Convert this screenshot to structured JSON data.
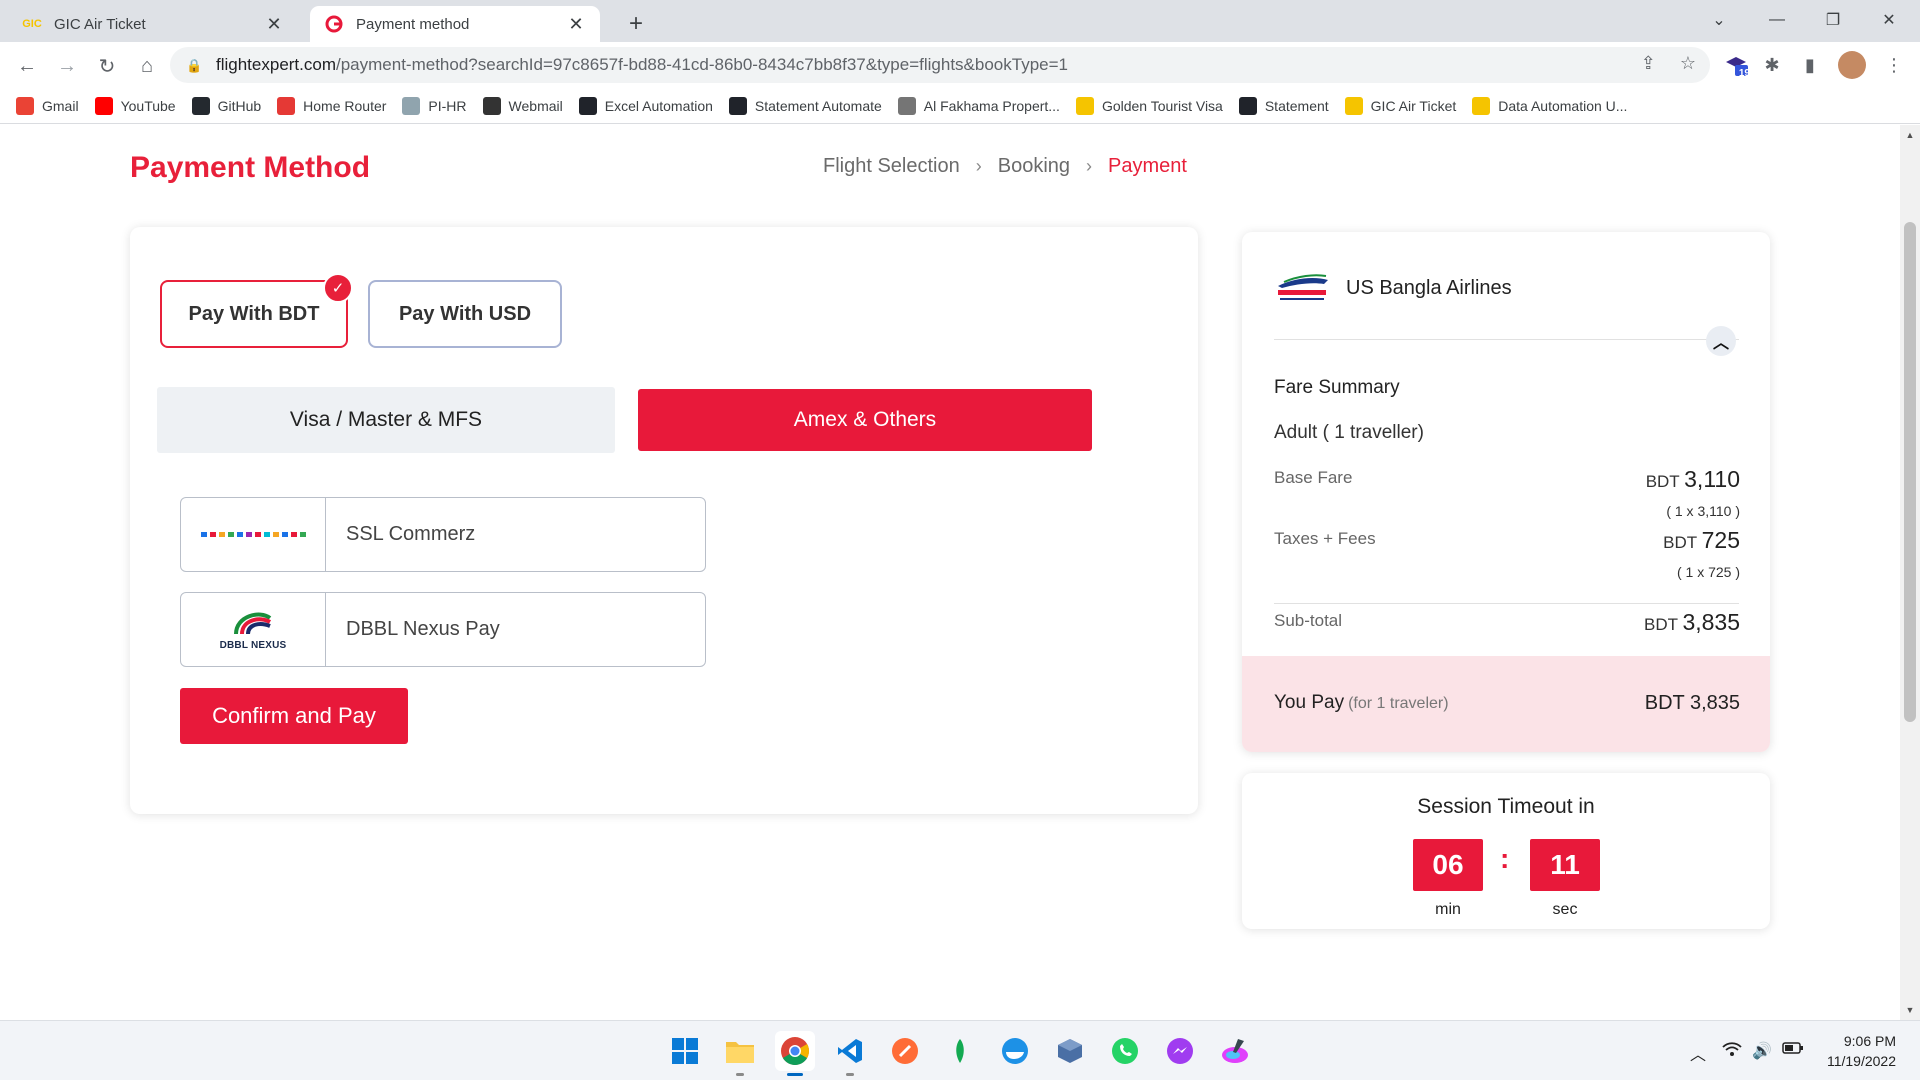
{
  "browser": {
    "tabs": [
      {
        "title": "GIC Air Ticket",
        "icon": "gic-favicon",
        "active": false
      },
      {
        "title": "Payment method",
        "icon": "flightexpert-favicon",
        "active": true
      }
    ],
    "url_host": "flightexpert.com",
    "url_path": "/payment-method?searchId=97c8657f-bd88-41cd-86b0-8434c7bb8f37&type=flights&bookType=1",
    "extension_badge": "19",
    "bookmarks": [
      {
        "label": "Gmail",
        "icon": "gmail-icon",
        "color": "#ea4335"
      },
      {
        "label": "YouTube",
        "icon": "youtube-icon",
        "color": "#ff0000"
      },
      {
        "label": "GitHub",
        "icon": "github-icon",
        "color": "#24292f"
      },
      {
        "label": "Home Router",
        "icon": "router-icon",
        "color": "#e53935"
      },
      {
        "label": "PI-HR",
        "icon": "document-icon",
        "color": "#90a4ae"
      },
      {
        "label": "Webmail",
        "icon": "webmail-icon",
        "color": "#333333"
      },
      {
        "label": "Excel Automation",
        "icon": "react-icon",
        "color": "#20232a"
      },
      {
        "label": "Statement Automate",
        "icon": "react-icon",
        "color": "#20232a"
      },
      {
        "label": "Al Fakhama Propert...",
        "icon": "page-icon",
        "color": "#757575"
      },
      {
        "label": "Golden Tourist Visa",
        "icon": "gic-icon",
        "color": "#f5c400"
      },
      {
        "label": "Statement",
        "icon": "react-icon",
        "color": "#20232a"
      },
      {
        "label": "GIC Air Ticket",
        "icon": "gic-icon",
        "color": "#f5c400"
      },
      {
        "label": "Data Automation U...",
        "icon": "gic-icon",
        "color": "#f5c400"
      }
    ]
  },
  "page": {
    "title": "Payment Method",
    "breadcrumb": [
      "Flight Selection",
      "Booking",
      "Payment"
    ],
    "currency_options": [
      {
        "label": "Pay With BDT",
        "selected": true
      },
      {
        "label": "Pay With USD",
        "selected": false
      }
    ],
    "method_tabs": [
      {
        "label": "Visa / Master & MFS",
        "active": false
      },
      {
        "label": "Amex & Others",
        "active": true
      }
    ],
    "gateways": [
      {
        "label": "SSL Commerz",
        "logo": "sslcommerz-logo"
      },
      {
        "label": "DBBL Nexus Pay",
        "logo": "dbbl-nexus-logo",
        "logo_text": "DBBL NEXUS"
      }
    ],
    "confirm_label": "Confirm and Pay",
    "accent_color": "#e8193a"
  },
  "fare": {
    "airline": "US Bangla Airlines",
    "summary_title": "Fare Summary",
    "passenger_line": "Adult ( 1 traveller)",
    "base_fare": {
      "label": "Base Fare",
      "currency": "BDT",
      "amount": "3,110",
      "detail": "( 1 x 3,110 )"
    },
    "taxes": {
      "label": "Taxes + Fees",
      "currency": "BDT",
      "amount": "725",
      "detail": "( 1 x 725 )"
    },
    "subtotal": {
      "label": "Sub-total",
      "currency": "BDT",
      "amount": "3,835"
    },
    "you_pay": {
      "label": "You Pay",
      "note": "(for 1 traveler)",
      "total": "BDT 3,835"
    }
  },
  "session": {
    "title": "Session Timeout in",
    "minutes": "06",
    "seconds": "11",
    "min_label": "min",
    "sec_label": "sec",
    "separator": ":"
  },
  "taskbar": {
    "apps": [
      "windows-start-icon",
      "file-explorer-icon",
      "chrome-icon",
      "vscode-icon",
      "postman-icon",
      "mongodb-icon",
      "docker-icon",
      "virtualbox-icon",
      "whatsapp-icon",
      "messenger-icon",
      "paint-icon"
    ],
    "time": "9:06 PM",
    "date": "11/19/2022"
  }
}
